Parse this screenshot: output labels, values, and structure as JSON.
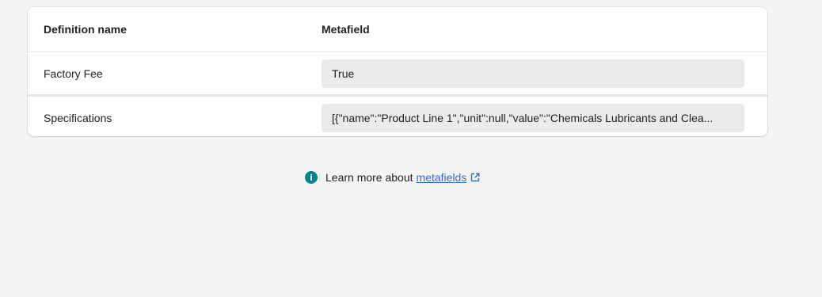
{
  "table": {
    "headers": [
      "Definition name",
      "Metafield"
    ],
    "rows": [
      {
        "name": "Factory Fee",
        "value": "True"
      },
      {
        "name": "Specifications",
        "value": "[{\"name\":\"Product Line 1\",\"unit\":null,\"value\":\"Chemicals Lubricants and Clea..."
      }
    ]
  },
  "footer": {
    "text": "Learn more about",
    "link_label": "metafields"
  },
  "colors": {
    "info_icon": "#00838f",
    "link": "#2c6ecb",
    "field_bg": "#ebebec"
  }
}
